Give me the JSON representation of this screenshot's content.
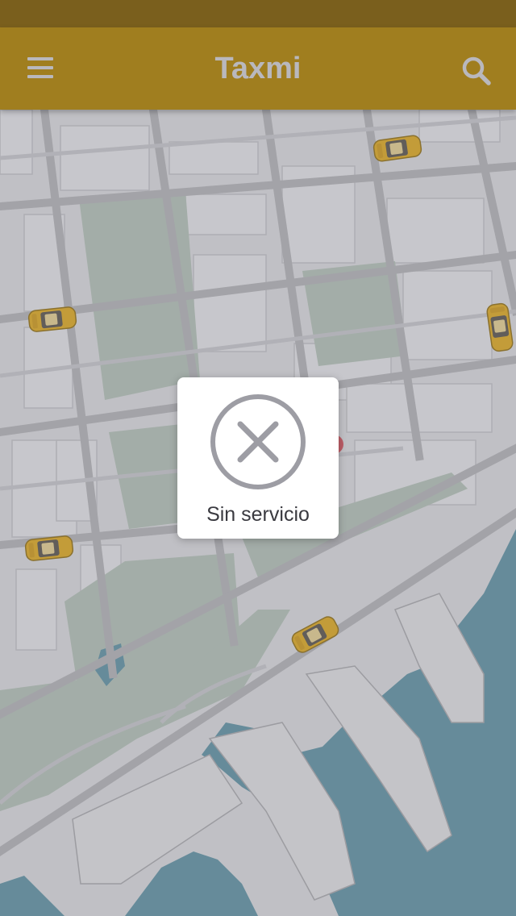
{
  "status_bar": {},
  "header": {
    "title": "Taxmi",
    "menu_icon": "hamburger-menu-icon",
    "search_icon": "search-icon",
    "color": "#a07e1f"
  },
  "map": {
    "taxi_icon": "taxi-car-icon",
    "taxis_count": 6,
    "water_color": "#5b8b9b",
    "park_color": "#a9b7ad"
  },
  "dialog": {
    "icon": "close-circle-icon",
    "message": "Sin servicio"
  }
}
